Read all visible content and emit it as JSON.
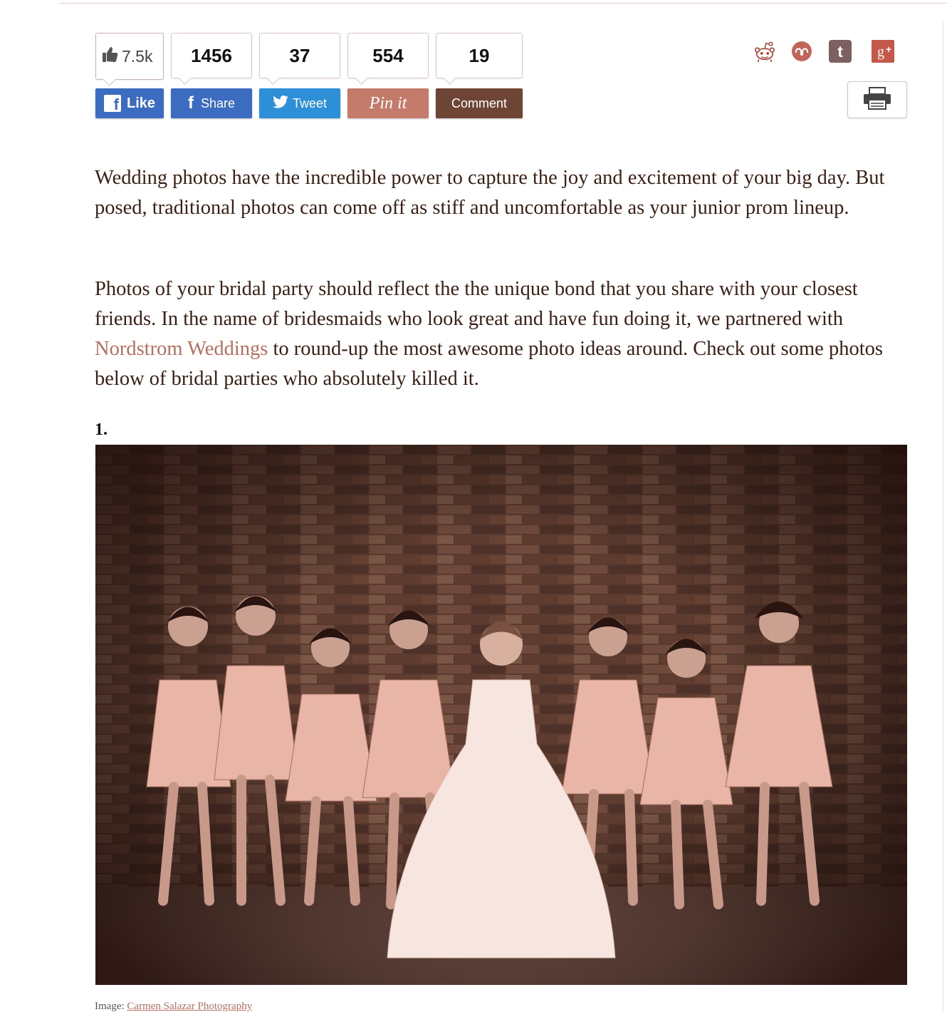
{
  "counters": {
    "facebook_likes": "7.5k",
    "share": "1456",
    "tweet": "37",
    "pin": "554",
    "comment": "19"
  },
  "buttons": {
    "like": "Like",
    "share": "Share",
    "tweet": "Tweet",
    "pin": "Pin it",
    "comment": "Comment"
  },
  "colors": {
    "facebook": "#3b6cc0",
    "twitter": "#2e8fd9",
    "pinterest": "#c47b6b",
    "comment": "#6e4434",
    "link": "#b56f5f",
    "text": "#3a1f14"
  },
  "social_icons": [
    "reddit-icon",
    "stumbleupon-icon",
    "tumblr-icon",
    "google-plus-icon",
    "print-icon"
  ],
  "article": {
    "paragraph1": "Wedding photos have the incredible power to capture the joy and excitement of your big day. But posed, traditional photos can come off as stiff and uncomfortable as your junior prom lineup.",
    "paragraph2_before": "Photos of your bridal party should reflect the the unique bond that you share with your closest friends. In the name of bridesmaids who look great and have fun doing it, we partnered with ",
    "paragraph2_link": "Nordstrom Weddings",
    "paragraph2_after": " to round-up the most awesome photo ideas around. Check out some photos below of bridal parties who absolutely killed it.",
    "item_number": "1.",
    "caption_label": "Image: ",
    "caption_link": "Carmen Salazar Photography"
  }
}
